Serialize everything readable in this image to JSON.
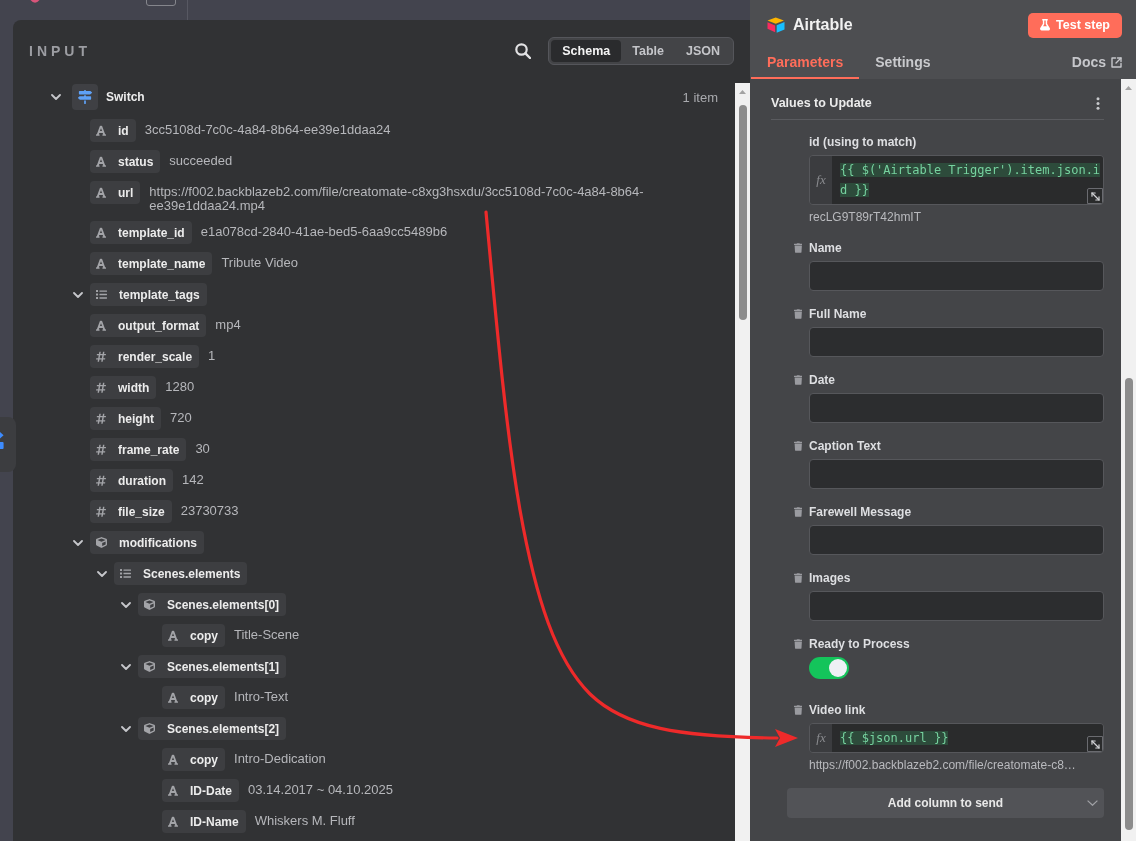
{
  "input_panel": {
    "title": "INPUT",
    "view_tabs": [
      {
        "label": "Schema",
        "selected": true
      },
      {
        "label": "Table",
        "selected": false
      },
      {
        "label": "JSON",
        "selected": false
      }
    ],
    "tree": [
      {
        "kind": "node",
        "key": "Switch",
        "count": "1 item",
        "expanded": true,
        "children": [
          {
            "kind": "string",
            "key": "id",
            "value": "3cc5108d-7c0c-4a84-8b64-ee39e1ddaa24"
          },
          {
            "kind": "string",
            "key": "status",
            "value": "succeeded"
          },
          {
            "kind": "string",
            "key": "url",
            "value": "https://f002.backblazeb2.com/file/creatomate-c8xg3hsxdu/3cc5108d-7c0c-4a84-8b64-ee39e1ddaa24.mp4"
          },
          {
            "kind": "string",
            "key": "template_id",
            "value": "e1a078cd-2840-41ae-bed5-6aa9cc5489b6"
          },
          {
            "kind": "string",
            "key": "template_name",
            "value": "Tribute Video"
          },
          {
            "kind": "array",
            "key": "template_tags",
            "expanded": true
          },
          {
            "kind": "string",
            "key": "output_format",
            "value": "mp4"
          },
          {
            "kind": "number",
            "key": "render_scale",
            "value": "1"
          },
          {
            "kind": "number",
            "key": "width",
            "value": "1280"
          },
          {
            "kind": "number",
            "key": "height",
            "value": "720"
          },
          {
            "kind": "number",
            "key": "frame_rate",
            "value": "30"
          },
          {
            "kind": "number",
            "key": "duration",
            "value": "142"
          },
          {
            "kind": "number",
            "key": "file_size",
            "value": "23730733"
          },
          {
            "kind": "object",
            "key": "modifications",
            "expanded": true,
            "children": [
              {
                "kind": "array",
                "key": "Scenes.elements",
                "expanded": true,
                "children": [
                  {
                    "kind": "object",
                    "key": "Scenes.elements[0]",
                    "expanded": true,
                    "children": [
                      {
                        "kind": "string",
                        "key": "copy",
                        "value": "Title-Scene"
                      }
                    ]
                  },
                  {
                    "kind": "object",
                    "key": "Scenes.elements[1]",
                    "expanded": true,
                    "children": [
                      {
                        "kind": "string",
                        "key": "copy",
                        "value": "Intro-Text"
                      }
                    ]
                  },
                  {
                    "kind": "object",
                    "key": "Scenes.elements[2]",
                    "expanded": true,
                    "children": [
                      {
                        "kind": "string",
                        "key": "copy",
                        "value": "Intro-Dedication"
                      },
                      {
                        "kind": "string",
                        "key": "ID-Date",
                        "value": "03.14.2017 ~ 04.10.2025"
                      },
                      {
                        "kind": "string",
                        "key": "ID-Name",
                        "value": "Whiskers M. Fluff"
                      }
                    ]
                  }
                ]
              }
            ]
          }
        ]
      }
    ]
  },
  "node_panel": {
    "title": "Airtable",
    "test_button": "Test step",
    "tabs": [
      {
        "label": "Parameters",
        "selected": true
      },
      {
        "label": "Settings",
        "selected": false
      }
    ],
    "docs_link": "Docs",
    "section": {
      "title": "Values to Update",
      "fields": [
        {
          "kind": "expression",
          "label": "id (using to match)",
          "removable": false,
          "mode": "fx",
          "expression": "{{ $('Airtable Trigger').item.json.id }}",
          "hint": "recLG9T89rT42hmIT"
        },
        {
          "kind": "text",
          "label": "Name",
          "removable": true
        },
        {
          "kind": "text",
          "label": "Full Name",
          "removable": true
        },
        {
          "kind": "text",
          "label": "Date",
          "removable": true
        },
        {
          "kind": "text",
          "label": "Caption Text",
          "removable": true
        },
        {
          "kind": "text",
          "label": "Farewell Message",
          "removable": true
        },
        {
          "kind": "text",
          "label": "Images",
          "removable": true
        },
        {
          "kind": "toggle",
          "label": "Ready to Process",
          "removable": true,
          "on": true
        },
        {
          "kind": "expression",
          "label": "Video link",
          "removable": true,
          "mode": "fx",
          "expression": "{{ $json.url }}",
          "hint": "https://f002.backblazeb2.com/file/creatomate-c8…"
        }
      ]
    },
    "add_button": "Add column to send"
  }
}
